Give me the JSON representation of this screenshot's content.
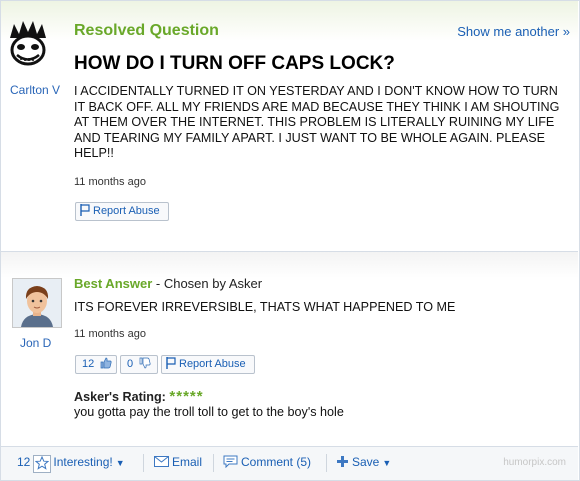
{
  "question": {
    "status": "Resolved Question",
    "show_another": "Show me another »",
    "asker_name": "Carlton V",
    "title": "HOW DO I TURN OFF CAPS LOCK?",
    "body": "I ACCIDENTALLY TURNED IT ON YESTERDAY AND I DON'T KNOW HOW TO TURN IT BACK OFF. ALL MY FRIENDS ARE MAD BECAUSE THEY THINK I AM SHOUTING AT THEM OVER THE INTERNET. THIS PROBLEM IS LITERALLY RUINING MY LIFE AND TEARING MY FAMILY APART. I JUST WANT TO BE WHOLE AGAIN. PLEASE HELP!!",
    "age": "11 months ago",
    "report_label": "Report Abuse"
  },
  "answer": {
    "label": "Best Answer",
    "chosen_by": " - Chosen by Asker",
    "answerer_name": "Jon D",
    "body": "ITS FOREVER IRREVERSIBLE, THATS WHAT HAPPENED TO ME",
    "age": "11 months ago",
    "thumbs_up_count": "12",
    "thumbs_down_count": "0",
    "report_label": "Report Abuse",
    "rating_label": "Asker's Rating:",
    "rating_stars": "*****",
    "rating_value": 5,
    "asker_comment": "you gotta pay the troll toll to get to the boy's hole"
  },
  "footer": {
    "interesting_count": "12",
    "interesting_label": "Interesting!",
    "email_label": "Email",
    "comment_label": "Comment (5)",
    "save_label": "Save",
    "watermark": "humorpix.com"
  },
  "colors": {
    "accent_green": "#69a829",
    "link_blue": "#1a5fb4"
  }
}
